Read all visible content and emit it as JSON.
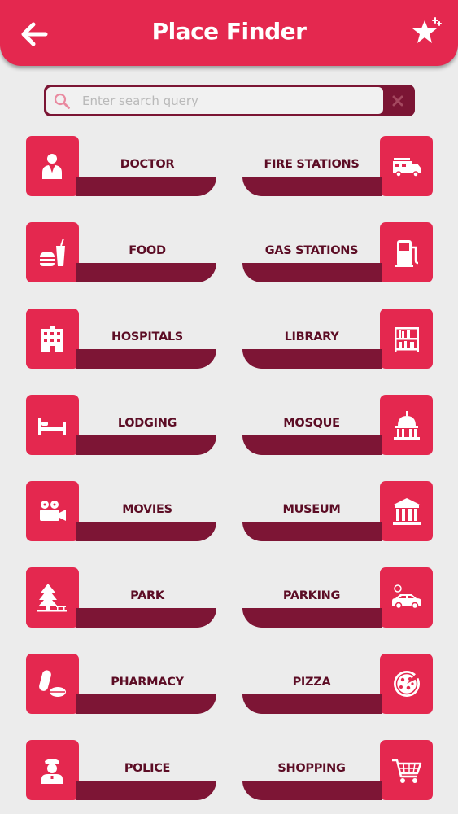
{
  "header": {
    "title": "Place Finder",
    "back_icon": "back-arrow-icon",
    "favorite_icon": "star-icon"
  },
  "search": {
    "placeholder": "Enter search query",
    "value": "",
    "search_icon": "search-icon",
    "clear_icon": "clear-icon"
  },
  "colors": {
    "primary": "#e4284f",
    "dark": "#7d1535",
    "label": "#5c0d25",
    "background": "#ececec"
  },
  "categories": [
    {
      "label": "DOCTOR",
      "icon": "doctor-icon"
    },
    {
      "label": "FIRE STATIONS",
      "icon": "fire-truck-icon"
    },
    {
      "label": "FOOD",
      "icon": "burger-drink-icon"
    },
    {
      "label": "GAS STATIONS",
      "icon": "fuel-pump-icon"
    },
    {
      "label": "HOSPITALS",
      "icon": "hospital-icon"
    },
    {
      "label": "LIBRARY",
      "icon": "bookshelf-icon"
    },
    {
      "label": "LODGING",
      "icon": "bed-icon"
    },
    {
      "label": "MOSQUE",
      "icon": "dome-icon"
    },
    {
      "label": "MOVIES",
      "icon": "movie-camera-icon"
    },
    {
      "label": "MUSEUM",
      "icon": "museum-icon"
    },
    {
      "label": "PARK",
      "icon": "tree-bench-icon"
    },
    {
      "label": "PARKING",
      "icon": "car-icon"
    },
    {
      "label": "PHARMACY",
      "icon": "pills-icon"
    },
    {
      "label": "PIZZA",
      "icon": "pizza-icon"
    },
    {
      "label": "POLICE",
      "icon": "police-officer-icon"
    },
    {
      "label": "SHOPPING",
      "icon": "shopping-cart-icon"
    }
  ]
}
